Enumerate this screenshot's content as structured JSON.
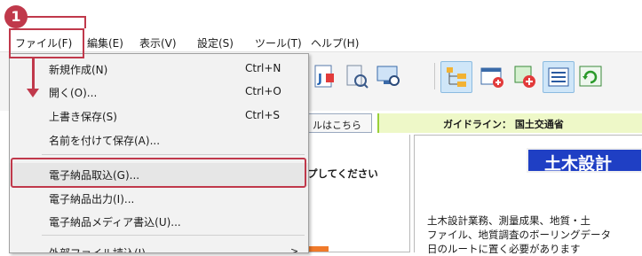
{
  "step_badge": "1",
  "menubar": {
    "items": [
      {
        "label": "ファイル(F)"
      },
      {
        "label": "編集(E)"
      },
      {
        "label": "表示(V)"
      },
      {
        "label": "設定(S)"
      },
      {
        "label": "ツール(T)"
      },
      {
        "label": "ヘルプ(H)"
      }
    ]
  },
  "file_menu": {
    "items": [
      {
        "label": "新規作成(N)",
        "shortcut": "Ctrl+N"
      },
      {
        "label": "開く(O)...",
        "shortcut": "Ctrl+O"
      },
      {
        "label": "上書き保存(S)",
        "shortcut": "Ctrl+S"
      },
      {
        "label": "名前を付けて保存(A)...",
        "shortcut": ""
      },
      {
        "label": "電子納品取込(G)...",
        "shortcut": ""
      },
      {
        "label": "電子納品出力(I)...",
        "shortcut": ""
      },
      {
        "label": "電子納品メディア書込(U)...",
        "shortcut": ""
      },
      {
        "label": "外部ファイル読込(I)",
        "shortcut": ">"
      }
    ]
  },
  "link_strip": {
    "link_text": "ルはこちら",
    "guideline": "ガイドライン： 国土交通省"
  },
  "left_pane": {
    "text": "プしてください"
  },
  "right_pane": {
    "banner": "土木設計",
    "lines": [
      "土木設計業務、測量成果、地質・土",
      "ファイル、地質調査のボーリングデータ",
      "日のルートに置く必要があります"
    ]
  },
  "colors": {
    "highlight_red": "#c0394b",
    "banner_blue": "#1f3fc4",
    "guideline_bg": "#eef8c8"
  }
}
